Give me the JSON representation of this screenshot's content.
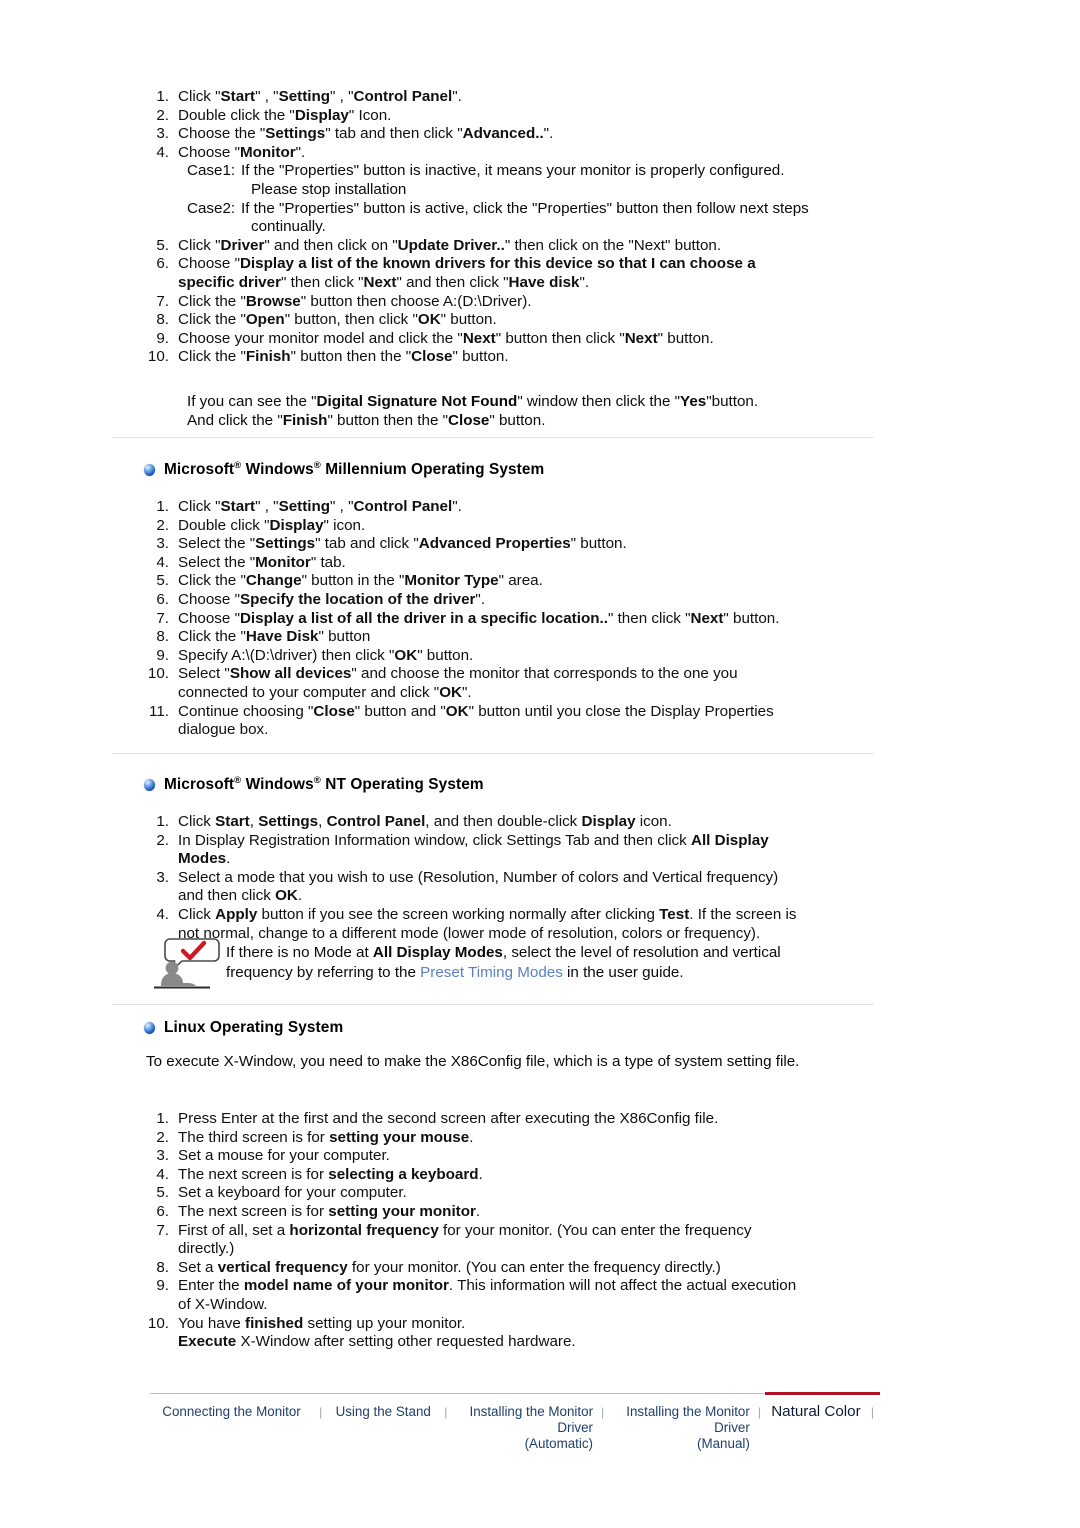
{
  "page": {
    "background": "#ffffff",
    "text_color": "#101010",
    "link_color": "#5b7fc0",
    "accent_red": "#b11226",
    "footer_link_color": "#1f3f6e",
    "divider_color": "#e2e2e2"
  },
  "section_windows2000": {
    "steps": [
      {
        "num": "1.",
        "html": "Click \"<b>Start</b>\" , \"<b>Setting</b>\" , \"<b>Control Panel</b>\"."
      },
      {
        "num": "2.",
        "html": "Double click the \"<b>Display</b>\" Icon."
      },
      {
        "num": "3.",
        "html": "Choose the \"<b>Settings</b>\" tab and then click \"<b>Advanced..</b>\"."
      },
      {
        "num": "4.",
        "html": "Choose \"<b>Monitor</b>\"."
      }
    ],
    "case1_label": "Case1:",
    "case1_text": "If the \"Properties\" button is inactive, it means your monitor is properly configured.",
    "case1_cont": "Please stop installation",
    "case2_label": "Case2:",
    "case2_text": "If the \"Properties\" button is active, click the \"Properties\" button then follow next steps",
    "case2_cont": "continually.",
    "steps_after": [
      {
        "num": "5.",
        "html": "Click \"<b>Driver</b>\" and then click on \"<b>Update Driver..</b>\" then click on the \"Next\" button."
      },
      {
        "num": "6.",
        "html": "Choose \"<b>Display a list of the known drivers for this device so that I can choose a<br>specific driver</b>\" then click \"<b>Next</b>\" and then click \"<b>Have disk</b>\"."
      },
      {
        "num": "7.",
        "html": "Click the \"<b>Browse</b>\" button then choose A:(D:\\Driver)."
      },
      {
        "num": "8.",
        "html": "Click the \"<b>Open</b>\" button, then click \"<b>OK</b>\" button."
      },
      {
        "num": "9.",
        "html": "Choose your monitor model and click the \"<b>Next</b>\" button then click \"<b>Next</b>\" button."
      },
      {
        "num": "10.",
        "html": "Click the \"<b>Finish</b>\" button then the \"<b>Close</b>\" button."
      }
    ],
    "note_line1": "If you can see the \"<b>Digital Signature Not Found</b>\" window then click the \"<b>Yes</b>\"button.",
    "note_line2": "And click the \"<b>Finish</b>\" button then the \"<b>Close</b>\" button."
  },
  "section_millennium": {
    "heading_html": "Microsoft<sup>&#174;</sup> Windows<sup>&#174;</sup> Millennium Operating System",
    "heading_plain": "Microsoft® Windows® Millennium Operating System",
    "bullet_icon": "blue-orb-bullet-icon",
    "steps": [
      {
        "num": "1.",
        "html": "Click \"<b>Start</b>\" , \"<b>Setting</b>\" , \"<b>Control Panel</b>\"."
      },
      {
        "num": "2.",
        "html": "Double click \"<b>Display</b>\" icon."
      },
      {
        "num": "3.",
        "html": "Select the \"<b>Settings</b>\" tab and click \"<b>Advanced Properties</b>\" button."
      },
      {
        "num": "4.",
        "html": "Select the \"<b>Monitor</b>\" tab."
      },
      {
        "num": "5.",
        "html": "Click the \"<b>Change</b>\" button in the \"<b>Monitor Type</b>\" area."
      },
      {
        "num": "6.",
        "html": "Choose \"<b>Specify the location of the driver</b>\"."
      },
      {
        "num": "7.",
        "html": "Choose \"<b>Display a list of all the driver in a specific location..</b>\" then click \"<b>Next</b>\" button."
      },
      {
        "num": "8.",
        "html": "Click the \"<b>Have Disk</b>\" button"
      },
      {
        "num": "9.",
        "html": "Specify A:\\(D:\\driver) then click \"<b>OK</b>\" button."
      },
      {
        "num": "10.",
        "html": "Select \"<b>Show all devices</b>\" and choose the monitor that corresponds to the one you<br>connected to your computer and click \"<b>OK</b>\"."
      },
      {
        "num": "11.",
        "html": "Continue choosing \"<b>Close</b>\" button and \"<b>OK</b>\" button until you close the Display Properties<br>dialogue box."
      }
    ]
  },
  "section_nt": {
    "heading_html": "Microsoft<sup>&#174;</sup> Windows<sup>&#174;</sup> NT Operating System",
    "heading_plain": "Microsoft® Windows® NT Operating System",
    "bullet_icon": "blue-orb-bullet-icon",
    "steps": [
      {
        "num": "1.",
        "html": "Click <b>Start</b>, <b>Settings</b>, <b>Control Panel</b>, and then double-click <b>Display</b> icon."
      },
      {
        "num": "2.",
        "html": "In Display Registration Information window, click Settings Tab and then click <b>All Display<br>Modes</b>."
      },
      {
        "num": "3.",
        "html": "Select a mode that you wish to use (Resolution, Number of colors and Vertical frequency)<br>and then click <b>OK</b>."
      },
      {
        "num": "4.",
        "html": "Click <b>Apply</b> button if you see the screen working normally after clicking <b>Test</b>. If the screen is<br>not normal, change to a different mode (lower mode of resolution, colors or frequency)."
      }
    ],
    "tip": {
      "icon": "person-speech-bubble-check-icon",
      "line1_pre": "If there is no Mode at ",
      "line1_bold": "All Display Modes",
      "line1_post": ", select the level of resolution and vertical",
      "line2_pre": "frequency by referring to the ",
      "line2_link": "Preset Timing Modes",
      "line2_post": " in the user guide."
    }
  },
  "section_linux": {
    "heading_plain": "Linux Operating System",
    "bullet_icon": "blue-orb-bullet-icon",
    "intro": "To execute X-Window, you need to make the X86Config file, which is a type of system setting file.",
    "steps": [
      {
        "num": "1.",
        "html": "Press Enter at the first and the second screen after executing the X86Config file."
      },
      {
        "num": "2.",
        "html": "The third screen is for <b>setting your mouse</b>."
      },
      {
        "num": "3.",
        "html": "Set a mouse for your computer."
      },
      {
        "num": "4.",
        "html": "The next screen is for <b>selecting a keyboard</b>."
      },
      {
        "num": "5.",
        "html": "Set a keyboard for your computer."
      },
      {
        "num": "6.",
        "html": "The next screen is for <b>setting your monitor</b>."
      },
      {
        "num": "7.",
        "html": "First of all, set a <b>horizontal frequency</b> for your monitor. (You can enter the frequency<br>directly.)"
      },
      {
        "num": "8.",
        "html": "Set a <b>vertical frequency</b> for your monitor. (You can enter the frequency directly.)"
      },
      {
        "num": "9.",
        "html": "Enter the <b>model name of your monitor</b>. This information will not affect the actual execution<br>of X-Window."
      },
      {
        "num": "10.",
        "html": "You have <b>finished</b> setting up your monitor.<br><b>Execute</b> X-Window after setting other requested hardware."
      }
    ]
  },
  "footer": {
    "separator": "|",
    "items": [
      {
        "label": "Connecting  the Monitor",
        "active": false
      },
      {
        "label": "Using the Stand",
        "active": false
      },
      {
        "label": "Installing the Monitor Driver\n(Automatic)",
        "active": false
      },
      {
        "label": "Installing the Monitor Driver\n(Manual)",
        "active": false
      },
      {
        "label": "Natural Color",
        "active": true
      }
    ]
  }
}
